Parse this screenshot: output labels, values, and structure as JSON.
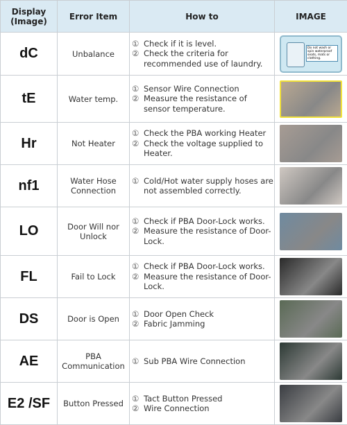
{
  "headers": {
    "display": "Display\n(Image)",
    "error": "Error Item",
    "how": "How to",
    "image": "IMAGE"
  },
  "rows": [
    {
      "code": "dC",
      "item": "Unbalance",
      "steps": [
        {
          "n": "①",
          "t": "Check if it is level."
        },
        {
          "n": "②",
          "t": "Check the criteria for recommended use of laundry."
        }
      ],
      "image": "sticker-illustration",
      "sticker_text": "Do not wash or spin waterproof seats, mats or clothing.",
      "color": "#cfe8f2"
    },
    {
      "code": "tE",
      "item": "Water temp.",
      "steps": [
        {
          "n": "①",
          "t": "Sensor Wire Connection"
        },
        {
          "n": "②",
          "t": "Measure the resistance of sensor temperature."
        }
      ],
      "image": "sensor-photo",
      "color": "#b9a891"
    },
    {
      "code": "Hr",
      "item": "Not Heater",
      "steps": [
        {
          "n": "①",
          "t": "Check the PBA working Heater"
        },
        {
          "n": "②",
          "t": "Check the voltage supplied to Heater."
        }
      ],
      "image": "heater-photo",
      "color": "#a79c94"
    },
    {
      "code": "nf1",
      "item": "Water Hose Connection",
      "steps": [
        {
          "n": "①",
          "t": "Cold/Hot water supply hoses are not assembled correctly."
        }
      ],
      "image": "hose-photo",
      "color": "#cfc8c2"
    },
    {
      "code": "LO",
      "item": "Door Will nor Unlock",
      "steps": [
        {
          "n": "①",
          "t": "Check if PBA Door-Lock works."
        },
        {
          "n": "②",
          "t": "Measure the resistance of Door-Lock."
        }
      ],
      "image": "washer-door-photo",
      "color": "#6f8aa0"
    },
    {
      "code": "FL",
      "item": "Fail to Lock",
      "steps": [
        {
          "n": "①",
          "t": "Check if PBA Door-Lock works."
        },
        {
          "n": "②",
          "t": "Measure the resistance of Door-Lock."
        }
      ],
      "image": "door-lock-photo",
      "color": "#2a2a2a"
    },
    {
      "code": "DS",
      "item": "Door is Open",
      "steps": [
        {
          "n": "①",
          "t": "Door Open Check"
        },
        {
          "n": "②",
          "t": "Fabric Jamming"
        }
      ],
      "image": "multimeter-photo",
      "color": "#5a6a55"
    },
    {
      "code": "AE",
      "item": "PBA Communication",
      "steps": [
        {
          "n": "①",
          "t": "Sub PBA Wire Connection"
        }
      ],
      "image": "pcb-photo",
      "color": "#2d3a35"
    },
    {
      "code": "E2 /SF",
      "item": "Button Pressed",
      "steps": [
        {
          "n": "①",
          "t": "Tact Button Pressed"
        },
        {
          "n": "②",
          "t": "Wire Connection"
        }
      ],
      "image": "control-panel-photo",
      "color": "#3a3d42"
    }
  ]
}
